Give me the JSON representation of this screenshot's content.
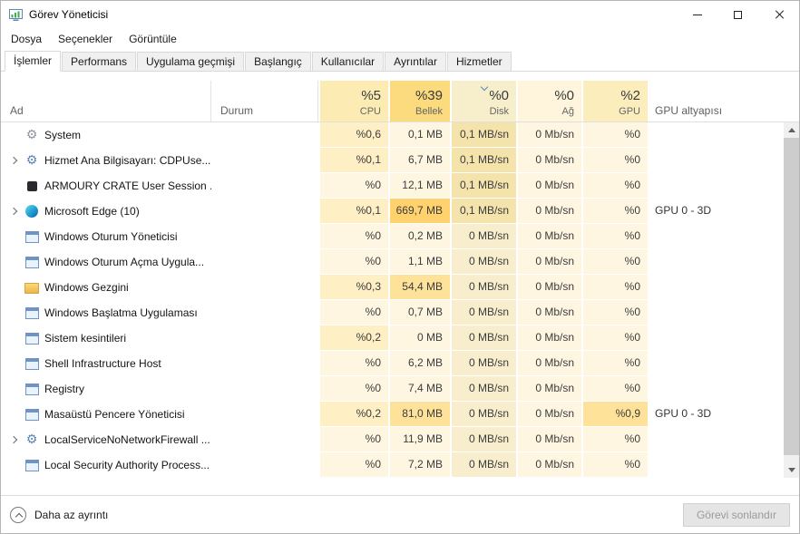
{
  "colors": {
    "accent": "#5b87b8",
    "heat0": "#fff6e1",
    "heat1": "#ffefc4",
    "heat2": "#ffe29a",
    "heat3": "#ffd26e",
    "heat0sel": "#f8eecd",
    "heat1sel": "#f5e3ac",
    "hcpu": "#fcecb4",
    "hmem": "#fbdb7e",
    "hdisk": "#f7eecb",
    "hnet": "#fef5dc",
    "hgpu": "#fceebc"
  },
  "window": {
    "title": "Görev Yöneticisi"
  },
  "menu": {
    "items": [
      {
        "label": "Dosya"
      },
      {
        "label": "Seçenekler"
      },
      {
        "label": "Görüntüle"
      }
    ]
  },
  "tabs": [
    {
      "label": "İşlemler",
      "active": true
    },
    {
      "label": "Performans"
    },
    {
      "label": "Uygulama geçmişi"
    },
    {
      "label": "Başlangıç"
    },
    {
      "label": "Kullanıcılar"
    },
    {
      "label": "Ayrıntılar"
    },
    {
      "label": "Hizmetler"
    }
  ],
  "columns": {
    "name": "Ad",
    "status": "Durum",
    "cpu": {
      "pct": "%5",
      "label": "CPU"
    },
    "mem": {
      "pct": "%39",
      "label": "Bellek"
    },
    "disk": {
      "pct": "%0",
      "label": "Disk",
      "sort": "descending"
    },
    "net": {
      "pct": "%0",
      "label": "Ağ"
    },
    "gpu": {
      "pct": "%2",
      "label": "GPU"
    },
    "gpu_engine": "GPU altyapısı"
  },
  "rows": [
    {
      "name": "System",
      "icon": "gear",
      "cpu": "%0,6",
      "mem": "0,1 MB",
      "disk": "0,1 MB/sn",
      "net": "0 Mb/sn",
      "gpu": "%0",
      "eng": ""
    },
    {
      "name": "Hizmet Ana Bilgisayarı: CDPUse...",
      "icon": "service-gear",
      "expandable": true,
      "cpu": "%0,1",
      "mem": "6,7 MB",
      "disk": "0,1 MB/sn",
      "net": "0 Mb/sn",
      "gpu": "%0",
      "eng": ""
    },
    {
      "name": "ARMOURY CRATE User Session ...",
      "icon": "armoury-crate",
      "cpu": "%0",
      "mem": "12,1 MB",
      "disk": "0,1 MB/sn",
      "net": "0 Mb/sn",
      "gpu": "%0",
      "eng": ""
    },
    {
      "name": "Microsoft Edge (10)",
      "icon": "edge",
      "expandable": true,
      "cpu": "%0,1",
      "mem": "669,7 MB",
      "disk": "0,1 MB/sn",
      "net": "0 Mb/sn",
      "gpu": "%0",
      "eng": "GPU 0 - 3D"
    },
    {
      "name": "Windows Oturum Yöneticisi",
      "icon": "app-window",
      "cpu": "%0",
      "mem": "0,2 MB",
      "disk": "0 MB/sn",
      "net": "0 Mb/sn",
      "gpu": "%0",
      "eng": ""
    },
    {
      "name": "Windows Oturum Açma Uygula...",
      "icon": "app-window",
      "cpu": "%0",
      "mem": "1,1 MB",
      "disk": "0 MB/sn",
      "net": "0 Mb/sn",
      "gpu": "%0",
      "eng": ""
    },
    {
      "name": "Windows Gezgini",
      "icon": "folder",
      "cpu": "%0,3",
      "mem": "54,4 MB",
      "disk": "0 MB/sn",
      "net": "0 Mb/sn",
      "gpu": "%0",
      "eng": ""
    },
    {
      "name": "Windows Başlatma Uygulaması",
      "icon": "app-window",
      "cpu": "%0",
      "mem": "0,7 MB",
      "disk": "0 MB/sn",
      "net": "0 Mb/sn",
      "gpu": "%0",
      "eng": ""
    },
    {
      "name": "Sistem kesintileri",
      "icon": "app-window",
      "cpu": "%0,2",
      "mem": "0 MB",
      "disk": "0 MB/sn",
      "net": "0 Mb/sn",
      "gpu": "%0",
      "eng": ""
    },
    {
      "name": "Shell Infrastructure Host",
      "icon": "app-window",
      "cpu": "%0",
      "mem": "6,2 MB",
      "disk": "0 MB/sn",
      "net": "0 Mb/sn",
      "gpu": "%0",
      "eng": ""
    },
    {
      "name": "Registry",
      "icon": "app-window",
      "cpu": "%0",
      "mem": "7,4 MB",
      "disk": "0 MB/sn",
      "net": "0 Mb/sn",
      "gpu": "%0",
      "eng": ""
    },
    {
      "name": "Masaüstü Pencere Yöneticisi",
      "icon": "app-window",
      "cpu": "%0,2",
      "mem": "81,0 MB",
      "disk": "0 MB/sn",
      "net": "0 Mb/sn",
      "gpu": "%0,9",
      "eng": "GPU 0 - 3D"
    },
    {
      "name": "LocalServiceNoNetworkFirewall ...",
      "icon": "service-gear",
      "expandable": true,
      "cpu": "%0",
      "mem": "11,9 MB",
      "disk": "0 MB/sn",
      "net": "0 Mb/sn",
      "gpu": "%0",
      "eng": ""
    },
    {
      "name": "Local Security Authority Process...",
      "icon": "app-window",
      "cpu": "%0",
      "mem": "7,2 MB",
      "disk": "0 MB/sn",
      "net": "0 Mb/sn",
      "gpu": "%0",
      "eng": ""
    }
  ],
  "footer": {
    "details_toggle": "Daha az ayrıntı",
    "end_task": "Görevi sonlandır",
    "end_task_enabled": false
  }
}
